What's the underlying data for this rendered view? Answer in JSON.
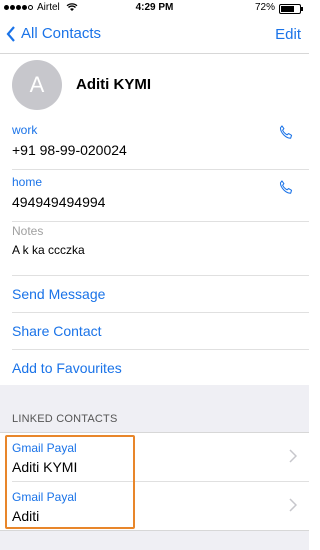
{
  "status_bar": {
    "carrier": "Airtel",
    "time": "4:29 PM",
    "battery_percent": "72%",
    "battery_level": 0.72
  },
  "nav": {
    "back_label": "All Contacts",
    "edit_label": "Edit"
  },
  "contact": {
    "avatar_initial": "A",
    "name": "Aditi KYMI"
  },
  "phones": [
    {
      "label": "work",
      "value": "+91 98-99-020024"
    },
    {
      "label": "home",
      "value": "494949494994"
    }
  ],
  "notes": {
    "label": "Notes",
    "value": "A k ka ccczka"
  },
  "actions": {
    "send_message": "Send Message",
    "share_contact": "Share Contact",
    "add_favourites": "Add to Favourites"
  },
  "linked": {
    "section_title": "LINKED CONTACTS",
    "items": [
      {
        "source": "Gmail Payal",
        "name": "Aditi KYMI"
      },
      {
        "source": "Gmail Payal",
        "name": "Aditi"
      }
    ]
  },
  "colors": {
    "accent": "#1a73e8",
    "highlight": "#e8862a",
    "avatar_bg": "#c7c7cc"
  },
  "icons": [
    "signal-dots-icon",
    "wifi-icon",
    "battery-icon",
    "back-chevron-icon",
    "phone-icon",
    "chevron-right-icon"
  ]
}
